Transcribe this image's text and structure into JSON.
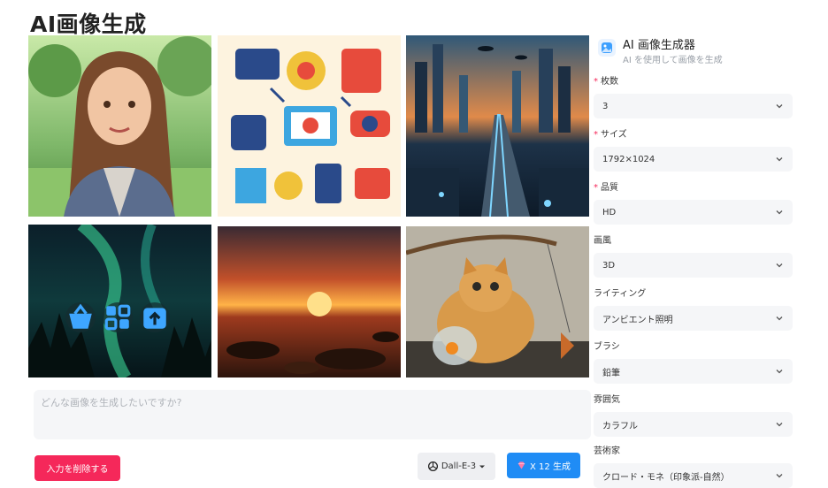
{
  "page": {
    "title": "AI画像生成"
  },
  "panel": {
    "title": "AI 画像生成器",
    "subtitle": "AI を使用して画像を生成",
    "fields": [
      {
        "label": "枚数",
        "required": true,
        "value": "3"
      },
      {
        "label": "サイズ",
        "required": true,
        "value": "1792×1024"
      },
      {
        "label": "品質",
        "required": true,
        "value": "HD"
      },
      {
        "label": "画風",
        "required": false,
        "value": "3D"
      },
      {
        "label": "ライティング",
        "required": false,
        "value": "アンビエント照明"
      },
      {
        "label": "ブラシ",
        "required": false,
        "value": "鉛筆"
      },
      {
        "label": "雰囲気",
        "required": false,
        "value": "カラフル"
      },
      {
        "label": "芸術家",
        "required": false,
        "value": "クロード・モネ（印象派-自然）"
      }
    ]
  },
  "prompt": {
    "placeholder": "どんな画像を生成したいですか?",
    "value": ""
  },
  "actions": {
    "clear_label": "入力を削除する",
    "model_label": "Dall-E-3",
    "generate_label": "X 12 生成"
  },
  "gallery": [
    {
      "subject": "cartoon woman in park"
    },
    {
      "subject": "colorful tech icons collage"
    },
    {
      "subject": "futuristic city at dusk"
    },
    {
      "subject": "aurora over forest"
    },
    {
      "subject": "sunset over rocky beach"
    },
    {
      "subject": "cat with fishing rod and goldfish jar"
    }
  ],
  "colors": {
    "accent": "#1f8cf5",
    "danger": "#f5285a",
    "field_bg": "#f5f6f8"
  }
}
